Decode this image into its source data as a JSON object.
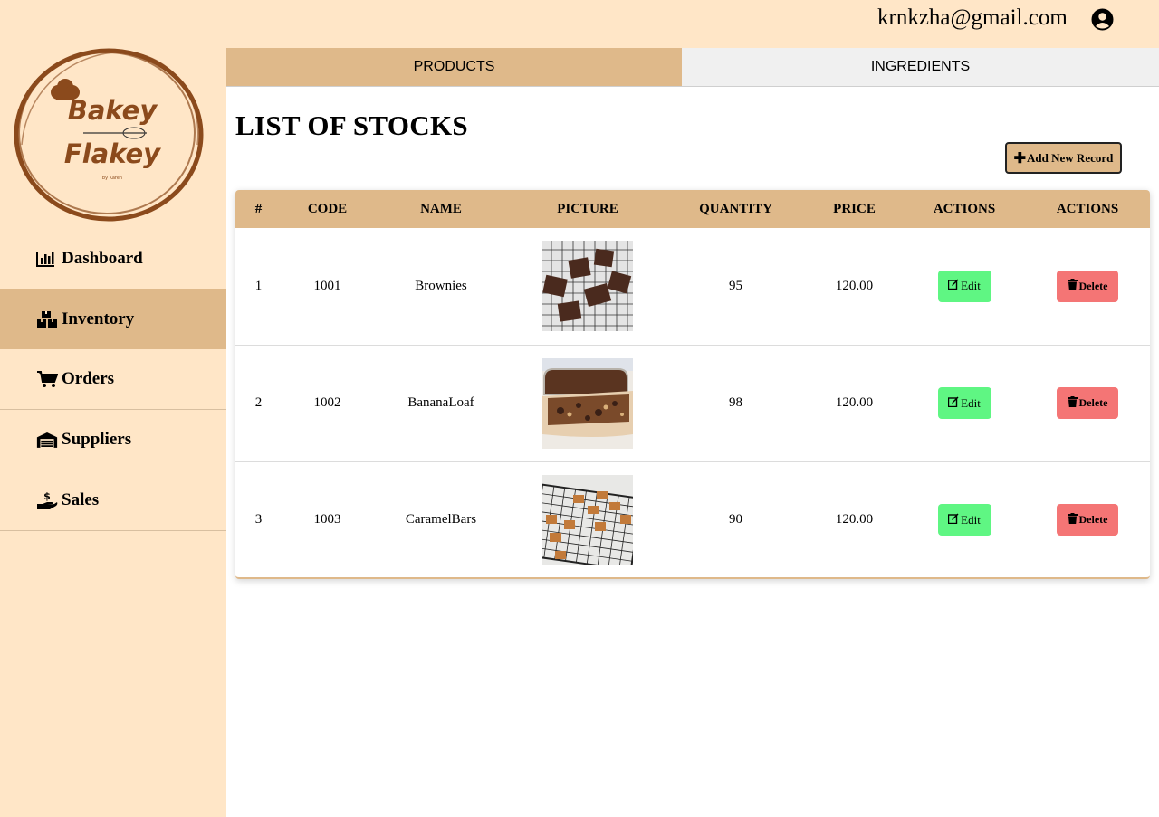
{
  "header": {
    "user_email": "krnkzha@gmail.com",
    "user_icon": "user-circle-icon"
  },
  "brand": {
    "logo_line1": "Bakey",
    "logo_line2": "Flakey",
    "logo_sub": "by Karen"
  },
  "sidebar": {
    "items": [
      {
        "label": "Dashboard",
        "icon": "chart-icon"
      },
      {
        "label": "Inventory",
        "icon": "boxes-icon",
        "active": true
      },
      {
        "label": "Orders",
        "icon": "cart-icon"
      },
      {
        "label": "Suppliers",
        "icon": "warehouse-icon"
      },
      {
        "label": "Sales",
        "icon": "hand-dollar-icon"
      }
    ]
  },
  "tabs": [
    {
      "label": "PRODUCTS",
      "active": true
    },
    {
      "label": "INGREDIENTS",
      "active": false
    }
  ],
  "main": {
    "title": "LIST OF STOCKS",
    "add_button": "Add New Record"
  },
  "table": {
    "headers": [
      "#",
      "CODE",
      "NAME",
      "PICTURE",
      "QUANTITY",
      "PRICE",
      "ACTIONS",
      "ACTIONS"
    ],
    "rows": [
      {
        "num": "1",
        "code": "1001",
        "name": "Brownies",
        "quantity": "95",
        "price": "120.00",
        "edit": "Edit",
        "delete": "Delete"
      },
      {
        "num": "2",
        "code": "1002",
        "name": "BananaLoaf",
        "quantity": "98",
        "price": "120.00",
        "edit": "Edit",
        "delete": "Delete"
      },
      {
        "num": "3",
        "code": "1003",
        "name": "CaramelBars",
        "quantity": "90",
        "price": "120.00",
        "edit": "Edit",
        "delete": "Delete"
      }
    ]
  },
  "colors": {
    "background": "#ffe6c7",
    "accent": "#dfb98a",
    "edit": "#5ff683",
    "delete": "#f47575",
    "brand": "#8b4a1c"
  }
}
